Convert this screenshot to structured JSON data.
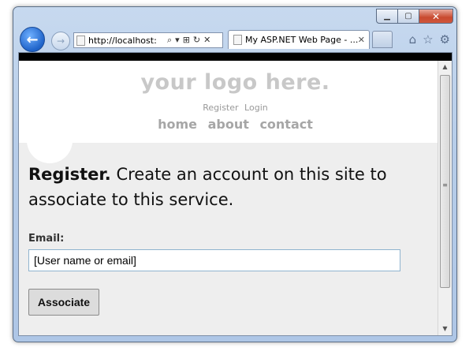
{
  "window": {
    "controls": {
      "minimize": "▁",
      "maximize": "▢",
      "close": "✕"
    }
  },
  "navbar": {
    "back_icon": "←",
    "forward_icon": "→",
    "address": "http://localhost:",
    "address_icons": [
      "⌕",
      "▾",
      "⊞",
      "↻",
      "✕"
    ],
    "tab_title": "My ASP.NET Web Page - ...",
    "tab_close": "✕",
    "tools": [
      "⌂",
      "☆",
      "⚙"
    ]
  },
  "site": {
    "logo": "your logo here.",
    "login_links": [
      "Register",
      "Login"
    ],
    "menu": [
      "home",
      "about",
      "contact"
    ]
  },
  "main": {
    "title": "Register.",
    "description": " Create an account on this site to associate to this service.",
    "email_label": "Email:",
    "email_value": "[User name or email]",
    "button": "Associate"
  }
}
